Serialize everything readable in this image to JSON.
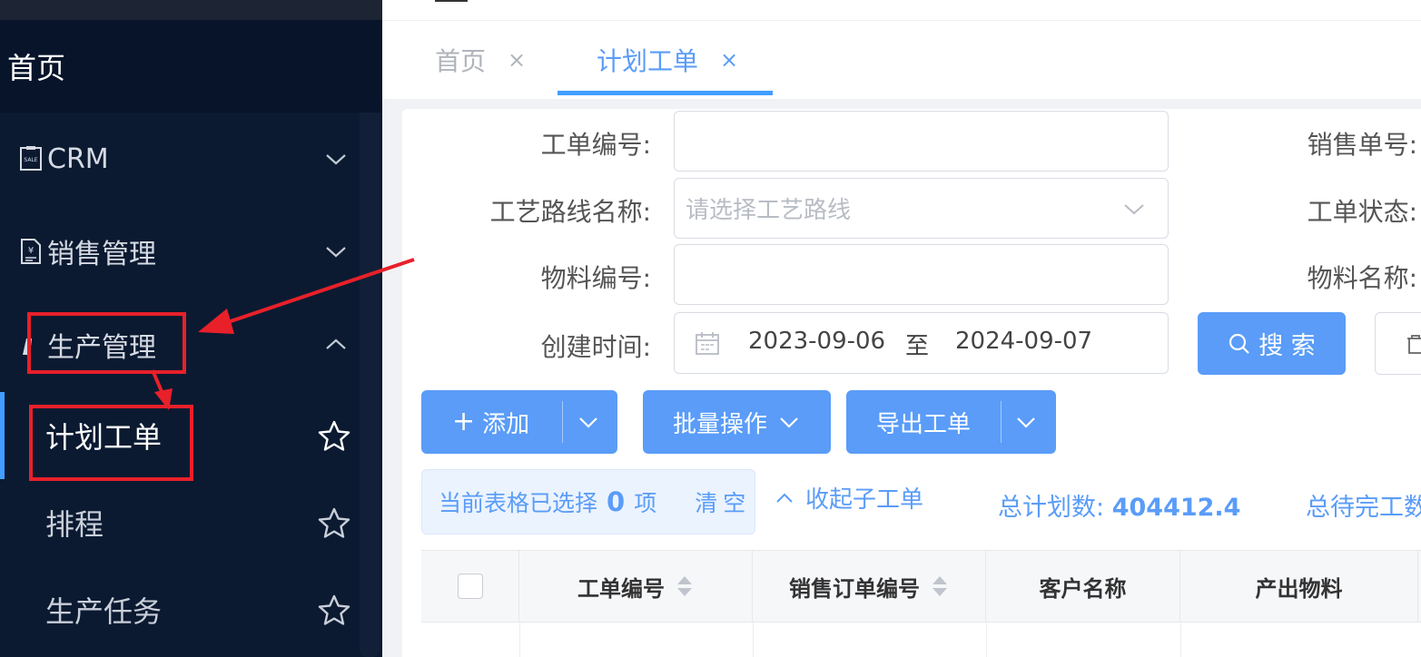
{
  "sidebar": {
    "home_label": "首页",
    "groups": [
      {
        "label": "CRM",
        "icon": "sale-tag-icon",
        "expanded": false
      },
      {
        "label": "销售管理",
        "icon": "sales-doc-icon",
        "expanded": false
      },
      {
        "label": "生产管理",
        "icon": "factory-icon",
        "expanded": true
      }
    ],
    "sub_items": [
      {
        "label": "计划工单",
        "active": true
      },
      {
        "label": "排程",
        "active": false
      },
      {
        "label": "生产任务",
        "active": false
      }
    ]
  },
  "tabs": [
    {
      "label": "首页",
      "close": "×",
      "active": false
    },
    {
      "label": "计划工单",
      "close": "×",
      "active": true
    }
  ],
  "filters": {
    "work_order_no": {
      "label": "工单编号:",
      "value": ""
    },
    "route_name": {
      "label": "工艺路线名称:",
      "placeholder": "请选择工艺路线"
    },
    "material_no": {
      "label": "物料编号:",
      "value": ""
    },
    "created_time": {
      "label": "创建时间:",
      "start": "2023-09-06",
      "separator": "至",
      "end": "2024-09-07"
    },
    "sales_no_label": "销售单号:",
    "status_label": "工单状态:",
    "material_name_label": "物料名称:"
  },
  "buttons": {
    "search": "搜 索",
    "add": "添加",
    "batch": "批量操作",
    "export": "导出工单"
  },
  "selection": {
    "prefix": "当前表格已选择",
    "count": "0",
    "suffix": "项",
    "clear": "清空"
  },
  "collapse_link": "收起子工单",
  "stats": {
    "total_plan_label": "总计划数:",
    "total_plan_value": "404412.4",
    "total_pending_label": "总待完工数"
  },
  "table": {
    "columns": [
      "工单编号",
      "销售订单编号",
      "客户名称",
      "产出物料"
    ]
  },
  "colors": {
    "sidebar_bg": "#0b1a31",
    "accent": "#409eff",
    "button": "#5a9cf8",
    "annotation": "#e8202a"
  }
}
